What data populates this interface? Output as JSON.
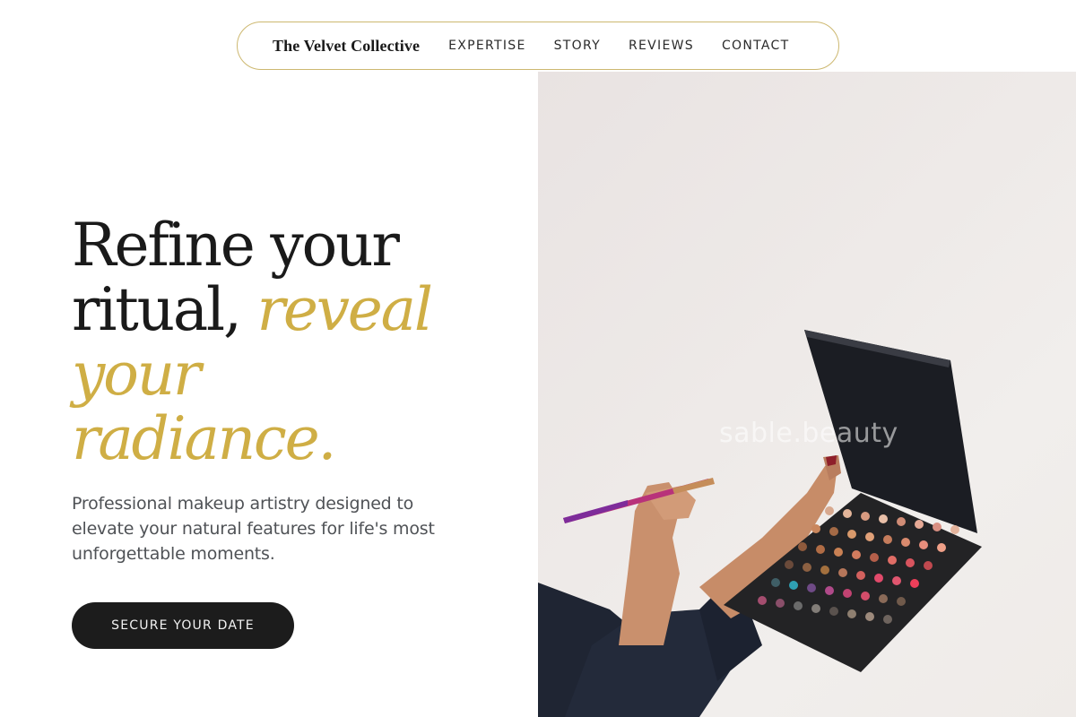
{
  "nav": {
    "brand": "The Velvet Collective",
    "links": [
      "EXPERTISE",
      "STORY",
      "REVIEWS",
      "CONTACT"
    ]
  },
  "hero": {
    "headline_line1": "Refine your",
    "headline_line2_plain": "ritual, ",
    "headline_line2_accent": "reveal",
    "headline_line3_accent": "your",
    "headline_line4_accent": "radiance.",
    "subtext": "Professional makeup artistry designed to elevate your natural features for life's most unforgettable moments.",
    "cta_label": "SECURE YOUR DATE"
  },
  "image": {
    "watermark": "sable.beauty",
    "subject": "hands holding an open eyeshadow palette and a makeup brush"
  },
  "colors": {
    "accent_gold": "#cfae45",
    "nav_border": "#cdb870",
    "cta_background": "#1c1c1c",
    "text_dark": "#1a1a1a",
    "text_muted": "#4f5256"
  }
}
